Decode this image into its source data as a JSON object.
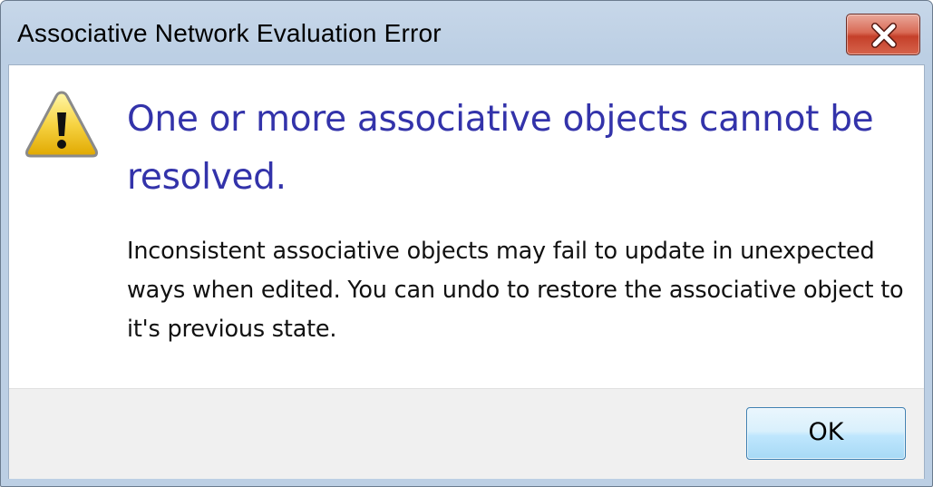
{
  "window": {
    "title": "Associative Network Evaluation Error",
    "close_icon": "close-x-icon"
  },
  "dialog": {
    "icon": "warning-triangle-icon",
    "main_instruction": "One or more associative objects cannot be resolved.",
    "content": "Inconsistent associative objects may fail to update in unexpected ways when edited. You can undo to restore the associative object to it's previous state."
  },
  "buttons": {
    "ok_label": "OK"
  },
  "colors": {
    "main_instruction": "#3333aa",
    "titlebar": "#c7d7e9",
    "close_button": "#c5402a",
    "footer": "#f0f0f0"
  }
}
